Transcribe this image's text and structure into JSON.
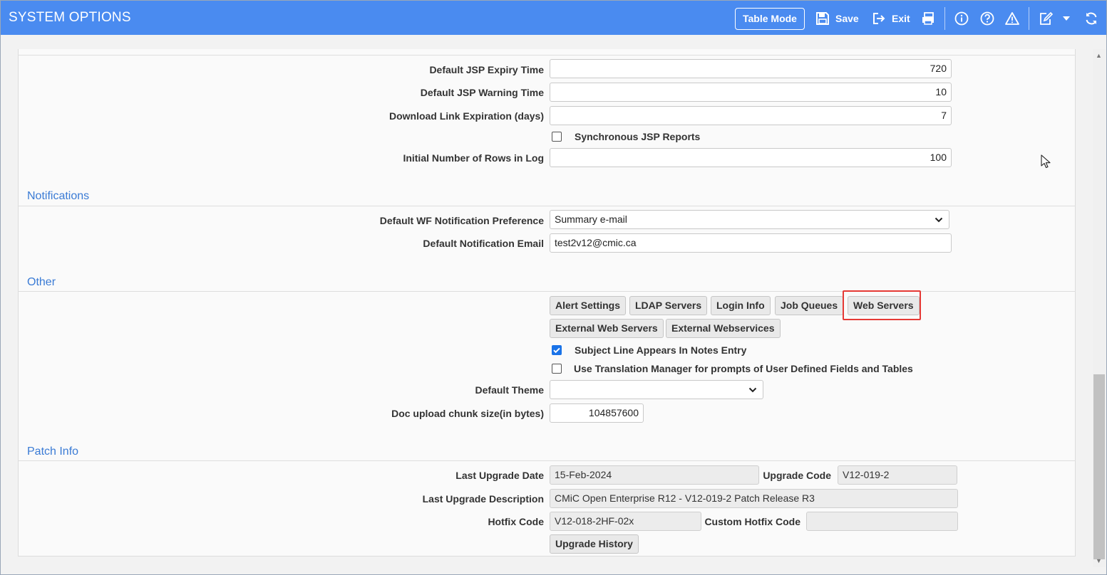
{
  "header": {
    "title": "SYSTEM OPTIONS",
    "table_mode": "Table Mode",
    "save": "Save",
    "exit": "Exit"
  },
  "general": {
    "jsp_expiry_label": "Default JSP Expiry Time",
    "jsp_expiry_value": "720",
    "jsp_warning_label": "Default JSP Warning Time",
    "jsp_warning_value": "10",
    "download_expiration_label": "Download Link Expiration (days)",
    "download_expiration_value": "7",
    "sync_jsp_label": "Synchronous JSP Reports",
    "sync_jsp_checked": false,
    "log_rows_label": "Initial Number of Rows in Log",
    "log_rows_value": "100"
  },
  "notifications": {
    "title": "Notifications",
    "wf_pref_label": "Default WF Notification Preference",
    "wf_pref_value": "Summary e-mail",
    "email_label": "Default Notification Email",
    "email_value": "test2v12@cmic.ca"
  },
  "other": {
    "title": "Other",
    "buttons": {
      "alert_settings": "Alert Settings",
      "ldap_servers": "LDAP Servers",
      "login_info": "Login Info",
      "job_queues": "Job Queues",
      "web_servers": "Web Servers",
      "external_web_servers": "External Web Servers",
      "external_webservices": "External Webservices"
    },
    "subject_line_label": "Subject Line Appears In Notes Entry",
    "subject_line_checked": true,
    "translation_label": "Use Translation Manager for prompts of User Defined Fields and Tables",
    "translation_checked": false,
    "theme_label": "Default Theme",
    "theme_value": "",
    "chunk_label": "Doc upload chunk size(in bytes)",
    "chunk_value": "104857600"
  },
  "patch_info": {
    "title": "Patch Info",
    "upgrade_date_label": "Last Upgrade Date",
    "upgrade_date_value": "15-Feb-2024",
    "upgrade_code_label": "Upgrade Code",
    "upgrade_code_value": "V12-019-2",
    "upgrade_desc_label": "Last Upgrade Description",
    "upgrade_desc_value": "CMiC Open Enterprise R12 - V12-019-2 Patch Release R3",
    "hotfix_label": "Hotfix Code",
    "hotfix_value": "V12-018-2HF-02x",
    "custom_hotfix_label": "Custom Hotfix Code",
    "custom_hotfix_value": "",
    "upgrade_history": "Upgrade History"
  },
  "colors": {
    "header": "#4a8bf0",
    "section_title": "#3a7bd5",
    "highlight": "#e53935",
    "checkbox_on": "#1a73e8"
  }
}
